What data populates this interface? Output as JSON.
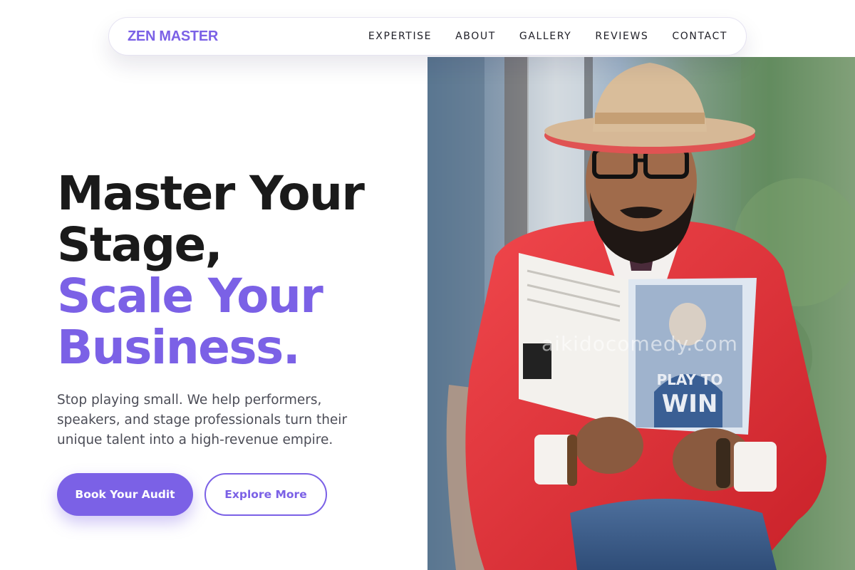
{
  "nav": {
    "brand": "ZEN MASTER",
    "links": [
      "EXPERTISE",
      "ABOUT",
      "GALLERY",
      "REVIEWS",
      "CONTACT"
    ]
  },
  "hero": {
    "headline_dark_1": "Master Your",
    "headline_dark_2": "Stage,",
    "headline_accent_1": "Scale Your",
    "headline_accent_2": "Business.",
    "subcopy": "Stop playing small. We help performers, speakers, and stage professionals turn their unique talent into a high-revenue empire.",
    "primary_button": "Book Your Audit",
    "secondary_button": "Explore More"
  },
  "photo": {
    "book_title_1": "PLAY TO",
    "book_title_2": "WIN",
    "watermark": "aikidocomedy.com"
  },
  "colors": {
    "accent": "#7b61e6",
    "heading": "#1a1a1a",
    "body_text": "#4c4d57",
    "jacket": "#e3343b"
  }
}
